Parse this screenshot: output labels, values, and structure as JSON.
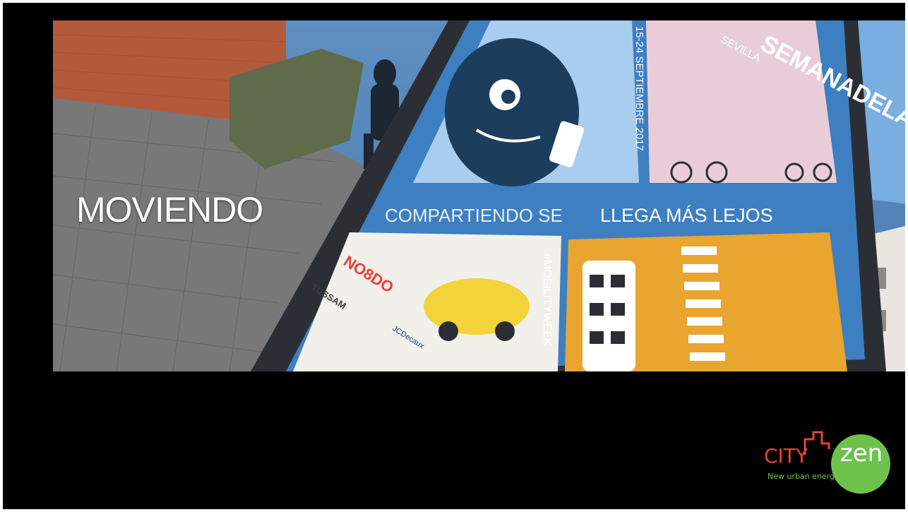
{
  "slide": {
    "headline": "MOVIENDO"
  },
  "photo": {
    "poster_title": "SEMANADELAMOVILIDAD",
    "poster_city": "SEVILLA",
    "poster_dates": "15-24 SEPTIEMBRE 2017",
    "poster_slogan_left": "COMPARTIENDO SE",
    "poster_slogan_right": "LLEGA MÁS LEJOS",
    "poster_hashtag": "#MOBILITYWEEK",
    "poster_sponsor_1": "NO8DO",
    "poster_sponsor_2": "TUSSAM",
    "poster_sponsor_3": "JCDecaux"
  },
  "logo": {
    "brand_left": "CITY",
    "brand_right": "zen",
    "tagline": "New urban energy",
    "colors": {
      "red": "#e8413a",
      "green": "#6dc24b"
    }
  }
}
